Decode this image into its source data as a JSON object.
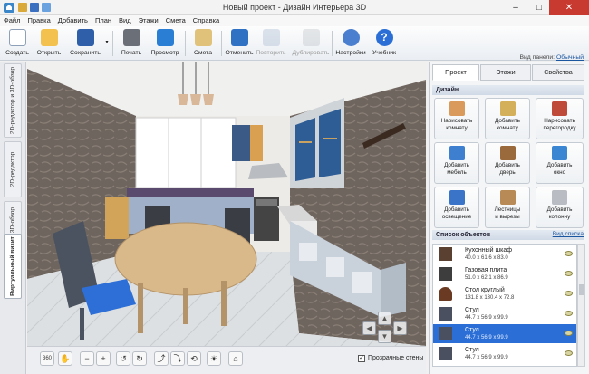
{
  "window": {
    "title": "Новый проект - Дизайн Интерьера 3D",
    "minimize": "–",
    "maximize": "□",
    "close": "✕"
  },
  "menu": [
    "Файл",
    "Правка",
    "Добавить",
    "План",
    "Вид",
    "Этажи",
    "Смета",
    "Справка"
  ],
  "toolbar": {
    "buttons": [
      {
        "label": "Создать",
        "icon": "new-file-icon",
        "color": "#ffffff"
      },
      {
        "label": "Открыть",
        "icon": "open-folder-icon",
        "color": "#f2c14e"
      },
      {
        "label": "Сохранить",
        "icon": "save-disk-icon",
        "color": "#2f5fa8"
      },
      {
        "label": "Печать",
        "icon": "printer-icon",
        "color": "#6b6f78"
      },
      {
        "label": "Просмотр",
        "icon": "monitor-icon",
        "color": "#2a7fd4"
      },
      {
        "label": "Смета",
        "icon": "estimate-icon",
        "color": "#e0c27a"
      },
      {
        "label": "Отменить",
        "icon": "undo-icon",
        "color": "#2f72c4"
      },
      {
        "label": "Повторить",
        "icon": "redo-icon",
        "color": "#9fb3cc"
      },
      {
        "label": "Дублировать",
        "icon": "duplicate-icon",
        "color": "#b8bcc4"
      },
      {
        "label": "Настройки",
        "icon": "gear-icon",
        "color": "#4a7fd0"
      },
      {
        "label": "Учебник",
        "icon": "help-icon",
        "color": "#2b6fd6"
      }
    ],
    "panel_view_label": "Вид панели:",
    "panel_view_value": "Обычный"
  },
  "left_tabs": [
    "2D-редактор и 3D-обзор",
    "2D-редактор",
    "3D-обзор",
    "Виртуальный визит"
  ],
  "right_panel": {
    "tabs": [
      "Проект",
      "Этажи",
      "Свойства"
    ],
    "design_header": "Дизайн",
    "design_buttons": [
      {
        "label": "Нарисовать\nкомнату",
        "icon": "draw-room-icon",
        "color": "#d99a5b"
      },
      {
        "label": "Добавить\nкомнату",
        "icon": "add-room-icon",
        "color": "#d4b05a"
      },
      {
        "label": "Нарисовать\nперегородку",
        "icon": "brick-wall-icon",
        "color": "#c04a3a"
      },
      {
        "label": "Добавить\nмебель",
        "icon": "chair-icon",
        "color": "#3f7fd0"
      },
      {
        "label": "Добавить\nдверь",
        "icon": "door-icon",
        "color": "#9a6a3c"
      },
      {
        "label": "Добавить\nокно",
        "icon": "window-icon",
        "color": "#3b86d2"
      },
      {
        "label": "Добавить\nосвещение",
        "icon": "lamp-icon",
        "color": "#3a74c8"
      },
      {
        "label": "Лестницы\nи вырезы",
        "icon": "stairs-icon",
        "color": "#b88a55"
      },
      {
        "label": "Добавить\nколонну",
        "icon": "column-icon",
        "color": "#b9bcc2"
      }
    ],
    "objects_header": "Список объектов",
    "list_view_label": "Вид списка",
    "objects": [
      {
        "name": "Кухонный шкаф",
        "dims": "40.0 x 61.6 x 83.0",
        "color": "#5a4030",
        "selected": false
      },
      {
        "name": "Газовая плита",
        "dims": "51.0 x 62.1 x 86.9",
        "color": "#3d3d3d",
        "selected": false
      },
      {
        "name": "Стол круглый",
        "dims": "131.8 x 130.4 x 72.8",
        "color": "#6b3a22",
        "selected": false
      },
      {
        "name": "Стул",
        "dims": "44.7 x 56.9 x 99.9",
        "color": "#4a5060",
        "selected": false
      },
      {
        "name": "Стул",
        "dims": "44.7 x 56.9 x 99.9",
        "color": "#4a5060",
        "selected": true
      },
      {
        "name": "Стул",
        "dims": "44.7 x 56.9 x 99.9",
        "color": "#4a5060",
        "selected": false
      }
    ]
  },
  "bottom_bar": {
    "transparent_walls_label": "Прозрачные стены",
    "transparent_walls_checked": "✓",
    "view_360": "360"
  }
}
